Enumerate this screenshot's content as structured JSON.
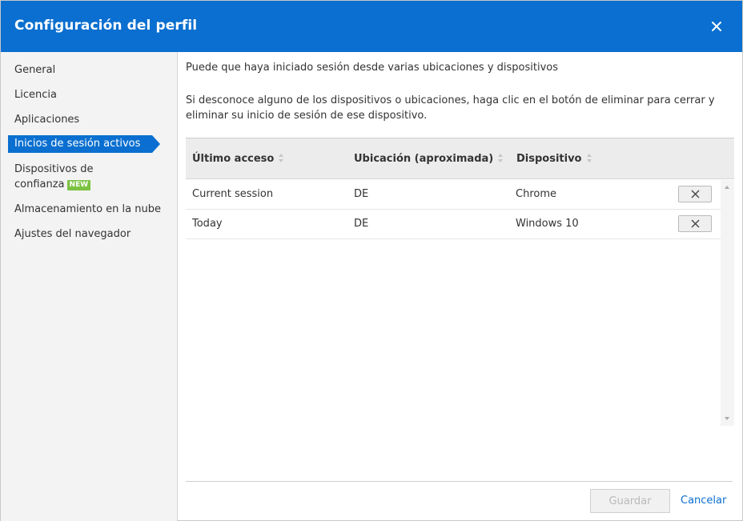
{
  "dialog": {
    "title": "Configuración del perfil",
    "close_icon": "close-icon"
  },
  "sidebar": {
    "items": [
      {
        "label": "General"
      },
      {
        "label": "Licencia"
      },
      {
        "label": "Aplicaciones"
      },
      {
        "label": "Inicios de sesión activos",
        "active": true
      },
      {
        "label_line1": "Dispositivos de",
        "label_line2": "confianza",
        "badge": "NEW"
      },
      {
        "label": "Almacenamiento en la nube"
      },
      {
        "label": "Ajustes del navegador"
      }
    ]
  },
  "main": {
    "intro": "Puede que haya iniciado sesión desde varias ubicaciones y dispositivos",
    "explanation": "Si desconoce alguno de los dispositivos o ubicaciones, haga clic en el botón de eliminar para cerrar y eliminar su inicio de sesión de ese dispositivo.",
    "table": {
      "columns": [
        "Último acceso",
        "Ubicación (aproximada)",
        "Dispositivo"
      ],
      "rows": [
        {
          "last_access": "Current session",
          "location": "DE",
          "device": "Chrome"
        },
        {
          "last_access": "Today",
          "location": "DE",
          "device": "Windows 10"
        }
      ]
    }
  },
  "footer": {
    "save_label": "Guardar",
    "cancel_label": "Cancelar"
  },
  "colors": {
    "accent": "#0a6fd0",
    "badge": "#7cc242"
  }
}
